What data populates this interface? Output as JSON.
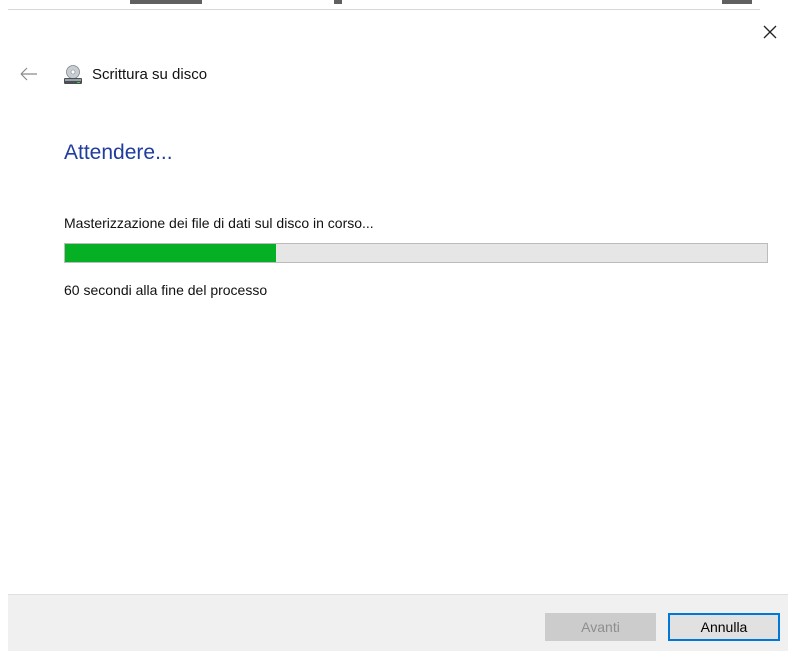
{
  "window": {
    "close_icon": "close-icon",
    "back_icon": "back-arrow-icon"
  },
  "header": {
    "icon": "disc-drive-icon",
    "title": "Scrittura su disco"
  },
  "main": {
    "heading": "Attendere...",
    "status": "Masterizzazione dei file di dati sul disco in corso...",
    "progress": {
      "percent": 30,
      "fill_color": "#06b025",
      "track_color": "#e6e6e6"
    },
    "time_remaining": "60 secondi alla fine del processo"
  },
  "footer": {
    "next_label": "Avanti",
    "next_enabled": false,
    "cancel_label": "Annulla",
    "accent_color": "#0078d7"
  },
  "colors": {
    "heading": "#1f3c9e",
    "footer_bg": "#f0f0f0"
  }
}
